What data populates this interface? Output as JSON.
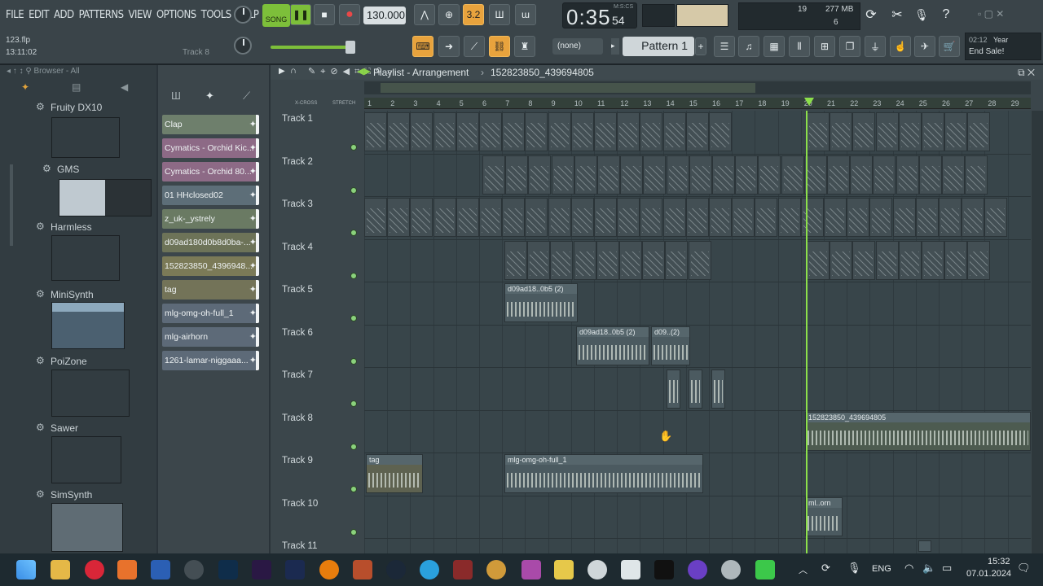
{
  "menu": [
    "FILE",
    "EDIT",
    "ADD",
    "PATTERNS",
    "VIEW",
    "OPTIONS",
    "TOOLS",
    "HELP"
  ],
  "transport": {
    "mode": "SONG",
    "tempo": "130.000",
    "time": "0:35",
    "time_sub": "54",
    "time_label": "M:S:CS"
  },
  "hint": {
    "file": "123.flp",
    "time": "13:11:02",
    "track": "Track 8"
  },
  "stats": {
    "cpu": "19",
    "mem": "277 MB",
    "poly": "6"
  },
  "pattern": {
    "none_label": "(none)",
    "name": "Pattern 1"
  },
  "news": {
    "time": "02:12",
    "line1": "Year",
    "line2": "End Sale!"
  },
  "browser": {
    "title": "Browser - All",
    "plugins": [
      {
        "name": "Fruity DX10"
      },
      {
        "name": "GMS"
      },
      {
        "name": "Harmless"
      },
      {
        "name": "MiniSynth"
      },
      {
        "name": "PoiZone"
      },
      {
        "name": "Sawer"
      },
      {
        "name": "SimSynth"
      }
    ]
  },
  "channels": [
    {
      "name": "Clap",
      "color": "#6e7f6c"
    },
    {
      "name": "Cymatics - Orchid Kic...",
      "color": "#8d6a86"
    },
    {
      "name": "Cymatics - Orchid 80...",
      "color": "#8d6a86"
    },
    {
      "name": "01 HHclosed02",
      "color": "#5d6e78"
    },
    {
      "name": "z_uk-_ystrely",
      "color": "#6a7a63"
    },
    {
      "name": "d09ad180d0b8d0ba-...",
      "color": "#6d7358"
    },
    {
      "name": "152823850_4396948...",
      "color": "#7b7a57"
    },
    {
      "name": "tag",
      "color": "#737358"
    },
    {
      "name": "mlg-omg-oh-full_1",
      "color": "#5d6a78"
    },
    {
      "name": "mlg-airhorn",
      "color": "#5d6a78"
    },
    {
      "name": "1261-lamar-niggaaa...",
      "color": "#5d6a78"
    }
  ],
  "playlist": {
    "title": "Playlist - Arrangement",
    "pattern": "152823850_439694805",
    "xcross": "X-CROSS",
    "stretch": "STRETCH"
  },
  "ruler": [
    "1",
    "2",
    "3",
    "4",
    "5",
    "6",
    "7",
    "8",
    "9",
    "10",
    "11",
    "12",
    "13",
    "14",
    "15",
    "16",
    "17",
    "18",
    "19",
    "20",
    "21",
    "22",
    "23",
    "24",
    "25",
    "26",
    "27",
    "28",
    "29"
  ],
  "tracks": [
    "Track 1",
    "Track 2",
    "Track 3",
    "Track 4",
    "Track 5",
    "Track 6",
    "Track 7",
    "Track 8",
    "Track 9",
    "Track 10",
    "Track 11"
  ],
  "clips": {
    "t5": "d09ad18..0b5 (2)",
    "t6a": "d09ad18..0b5 (2)",
    "t6b": "d09..(2)",
    "t8": "152823850_439694805",
    "t9a": "tag",
    "t9b": "mlg-omg-oh-full_1",
    "t10": "ml..orn"
  },
  "taskbar": {
    "lang": "ENG",
    "time": "15:32",
    "date": "07.01.2024"
  }
}
